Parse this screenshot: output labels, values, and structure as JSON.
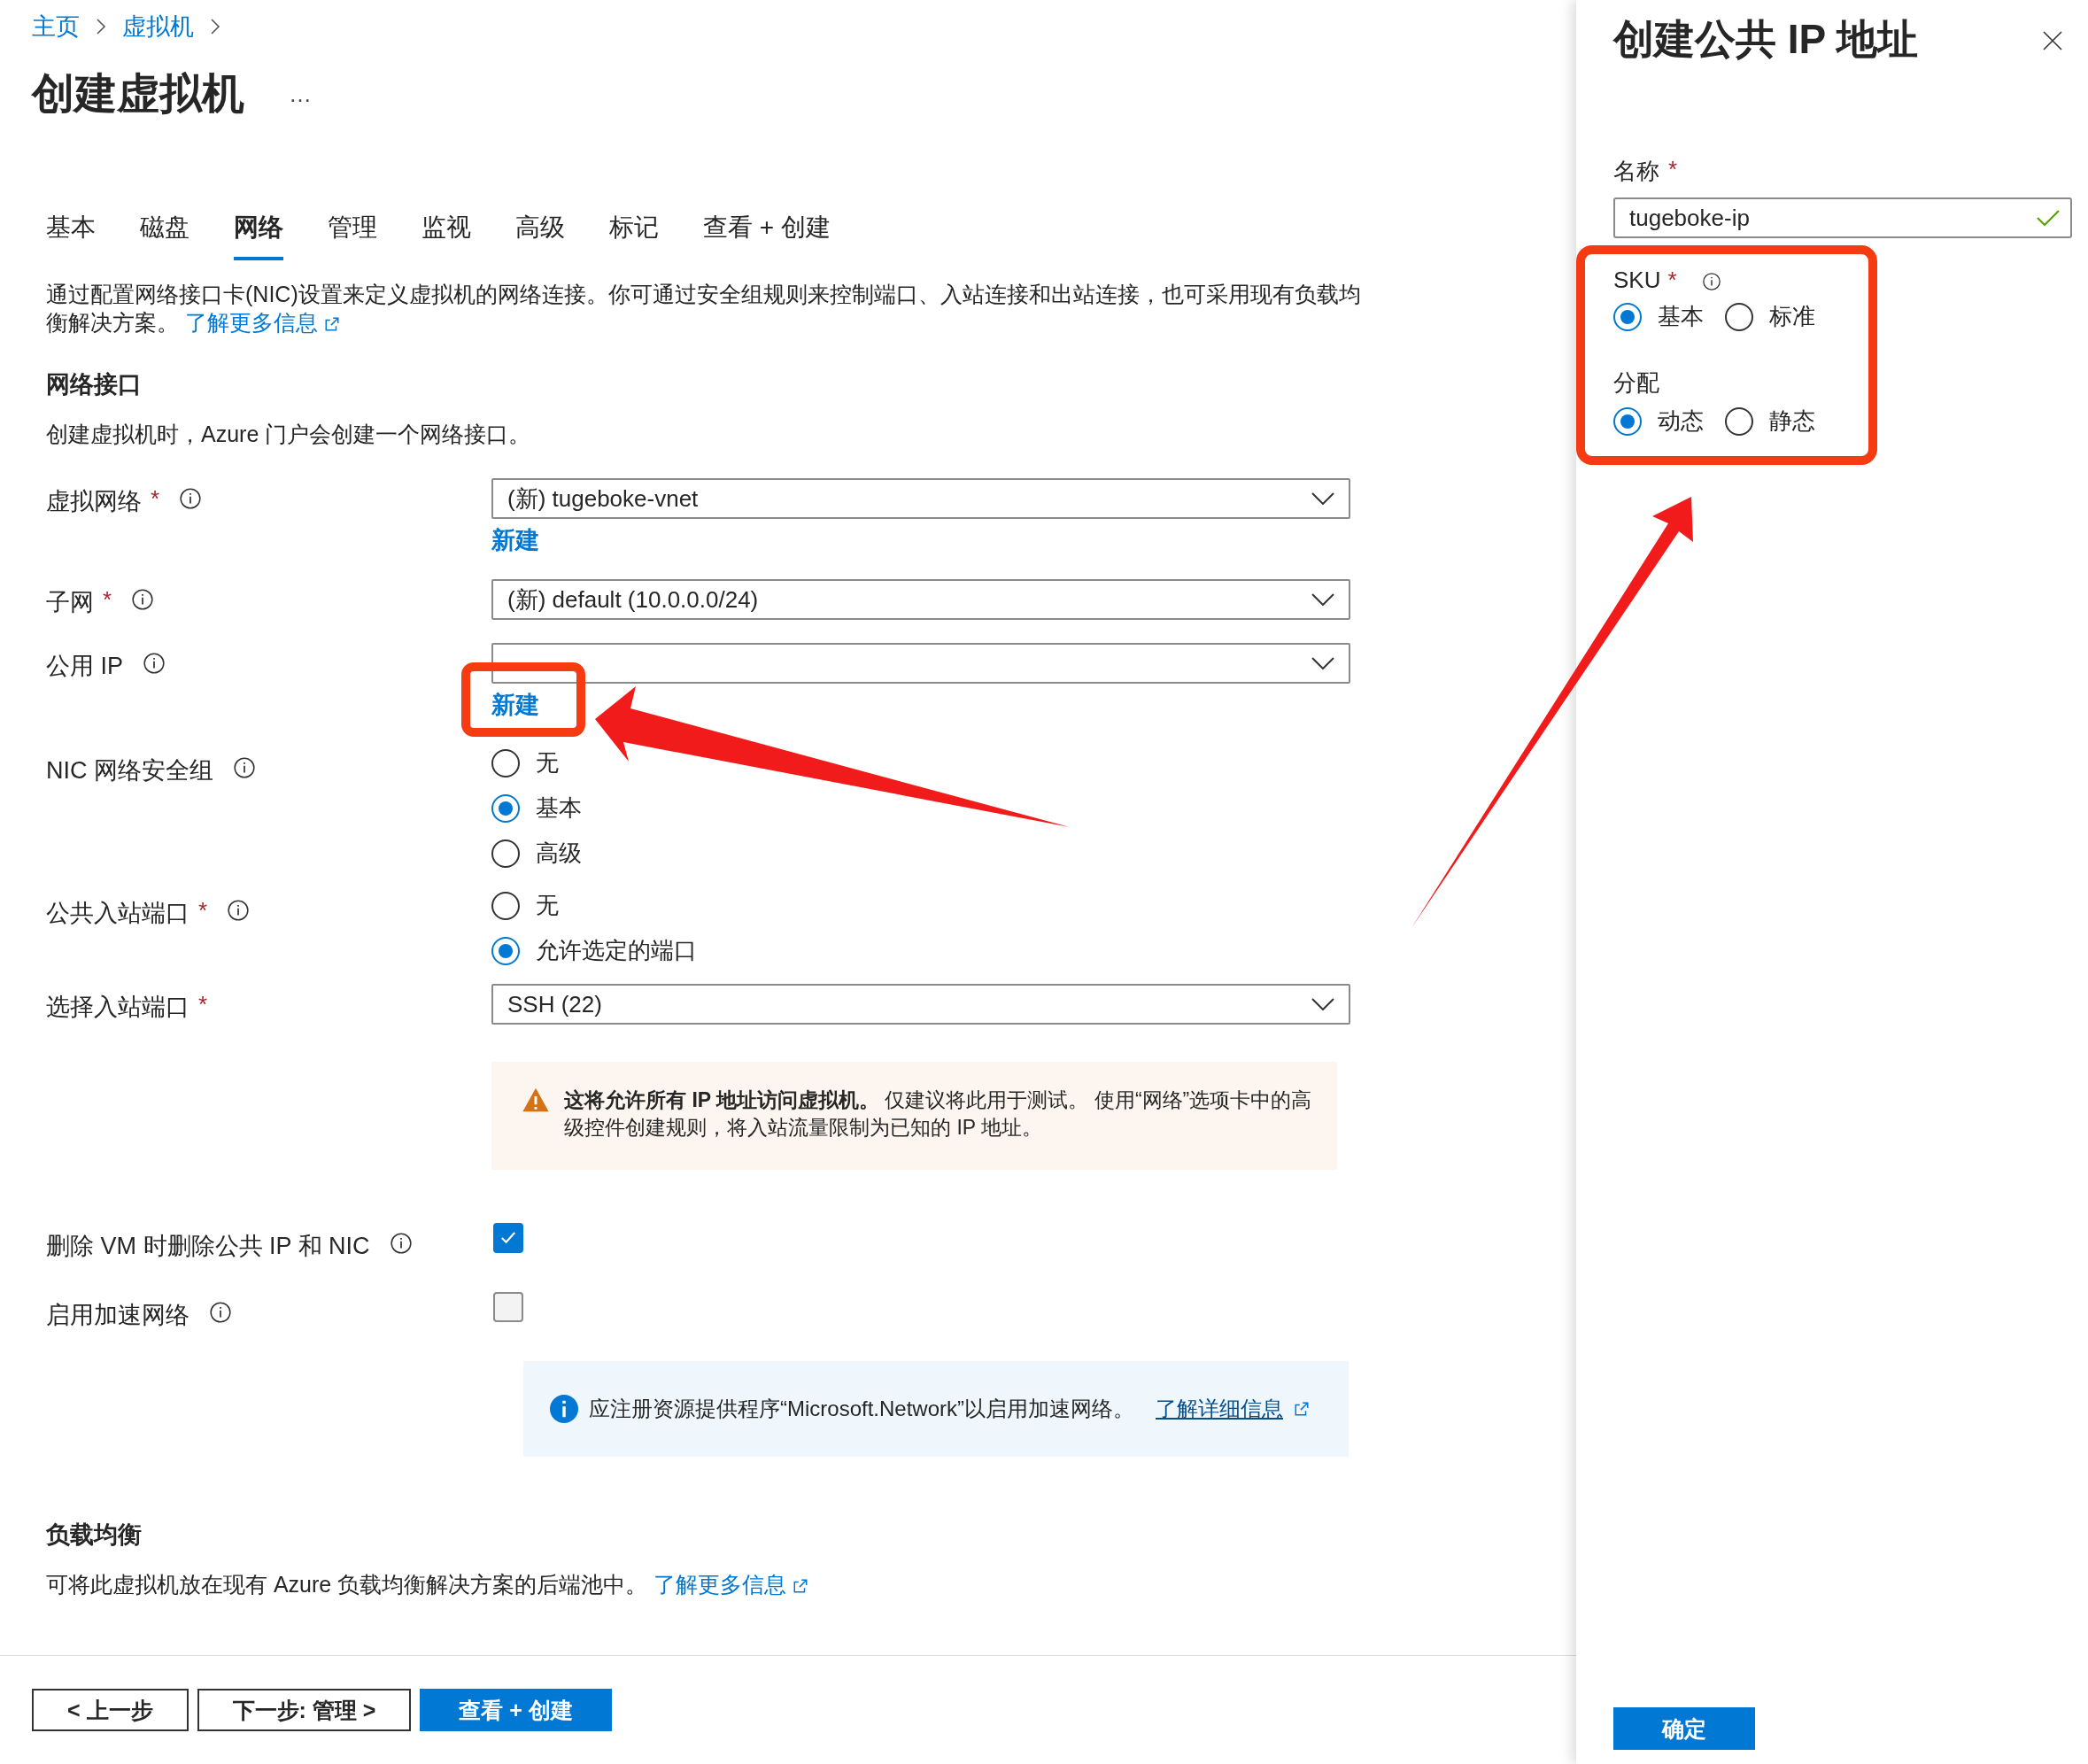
{
  "breadcrumb": [
    {
      "label": "主页"
    },
    {
      "label": "虚拟机"
    }
  ],
  "page_title": "创建虚拟机",
  "more_button": "…",
  "tabs": [
    {
      "label": "基本",
      "selected": false
    },
    {
      "label": "磁盘",
      "selected": false
    },
    {
      "label": "网络",
      "selected": true
    },
    {
      "label": "管理",
      "selected": false
    },
    {
      "label": "监视",
      "selected": false
    },
    {
      "label": "高级",
      "selected": false
    },
    {
      "label": "标记",
      "selected": false
    },
    {
      "label": "查看 + 创建",
      "selected": false
    }
  ],
  "intro": {
    "text": "通过配置网络接口卡(NIC)设置来定义虚拟机的网络连接。你可通过安全组规则来控制端口、入站连接和出站连接，也可采用现有负载均衡解决方案。",
    "link": "了解更多信息"
  },
  "network_interface": {
    "heading": "网络接口",
    "description": "创建虚拟机时，Azure 门户会创建一个网络接口。"
  },
  "fields": [
    {
      "kind": "select",
      "label": "虚拟网络",
      "required_mark": "*",
      "info": true,
      "value": "(新) tugeboke-vnet",
      "link": "新建",
      "link_highlighted": false
    },
    {
      "kind": "select",
      "label": "子网",
      "required_mark": "*",
      "info": true,
      "value": "(新) default (10.0.0.0/24)"
    },
    {
      "kind": "select",
      "label": "公用 IP",
      "info": true,
      "link": "新建",
      "link_highlighted": true
    },
    {
      "kind": "radio",
      "label": "NIC 网络安全组",
      "info": true,
      "options": [
        {
          "label": "无",
          "selected": false
        },
        {
          "label": "基本",
          "selected": true
        },
        {
          "label": "高级",
          "selected": false
        }
      ]
    },
    {
      "kind": "radio",
      "label": "公共入站端口",
      "required_mark": "*",
      "info": true,
      "options": [
        {
          "label": "无",
          "selected": false
        },
        {
          "label": "允许选定的端口",
          "selected": true
        }
      ]
    },
    {
      "kind": "select",
      "label": "选择入站端口",
      "required_mark": "*",
      "value": "SSH (22)"
    },
    {
      "kind": "warning",
      "text": "**这将允许所有 IP 地址访问虚拟机。** 仅建议将此用于测试。 使用“网络”选项卡中的高级控件创建规则，将入站流量限制为已知的 IP 地址。"
    },
    {
      "kind": "checkbox",
      "label": "删除 VM 时删除公共 IP 和 NIC",
      "info": true,
      "checked": true
    },
    {
      "kind": "checkbox",
      "label": "启用加速网络",
      "info": true,
      "checked": false
    },
    {
      "kind": "info",
      "text": "应注册资源提供程序“Microsoft.Network”以启用加速网络。",
      "link": "了解详细信息"
    }
  ],
  "load_balancing": {
    "heading": "负载均衡",
    "description": "可将此虚拟机放在现有 Azure 负载均衡解决方案的后端池中。",
    "link": "了解更多信息"
  },
  "footer_buttons": [
    {
      "label": "< 上一步",
      "primary": false
    },
    {
      "label": "下一步: 管理 >",
      "primary": false
    },
    {
      "label": "查看 + 创建",
      "primary": true
    }
  ],
  "panel": {
    "title": "创建公共 IP 地址",
    "name_field": {
      "label": "名称",
      "required_mark": "*",
      "value": "tugeboke-ip",
      "valid": true
    },
    "options_highlighted": true,
    "groups": [
      {
        "label": "SKU",
        "required_mark": "*",
        "info": true,
        "options": [
          {
            "label": "基本",
            "selected": true
          },
          {
            "label": "标准",
            "selected": false
          }
        ]
      },
      {
        "label": "分配",
        "options": [
          {
            "label": "动态",
            "selected": true
          },
          {
            "label": "静态",
            "selected": false
          }
        ]
      }
    ],
    "ok_button": "确定"
  }
}
